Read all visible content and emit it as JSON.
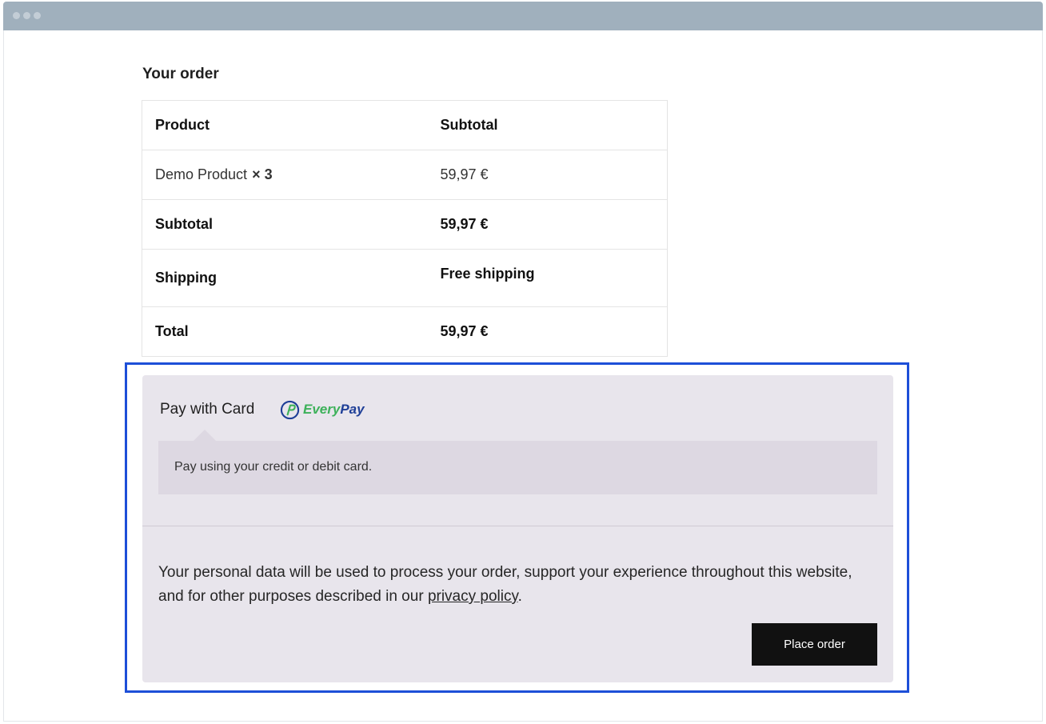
{
  "order": {
    "heading": "Your order",
    "table": {
      "header": {
        "product": "Product",
        "subtotal": "Subtotal"
      },
      "items": [
        {
          "name": "Demo Product",
          "quantity": "× 3",
          "subtotal": "59,97 €"
        }
      ],
      "subtotal": {
        "label": "Subtotal",
        "value": "59,97 €"
      },
      "shipping": {
        "label": "Shipping",
        "value": "Free shipping"
      },
      "total": {
        "label": "Total",
        "value": "59,97 €"
      }
    }
  },
  "payment": {
    "method_label": "Pay with Card",
    "logo": {
      "part1": "Every",
      "part2": "Pay",
      "colors": {
        "green": "#3db15a",
        "blue": "#1f3f97"
      }
    },
    "description": "Pay using your credit or debit card.",
    "privacy_notice": {
      "before": "Your personal data will be used to process your order, support your experience throughout this website, and for other purposes described in our ",
      "link": "privacy policy",
      "after": "."
    },
    "place_order_label": "Place order"
  },
  "colors": {
    "chrome": "#a0b0bd",
    "payment_bg": "#e8e5ec",
    "focus_outline": "#1d4fd8",
    "button_bg": "#111111"
  }
}
